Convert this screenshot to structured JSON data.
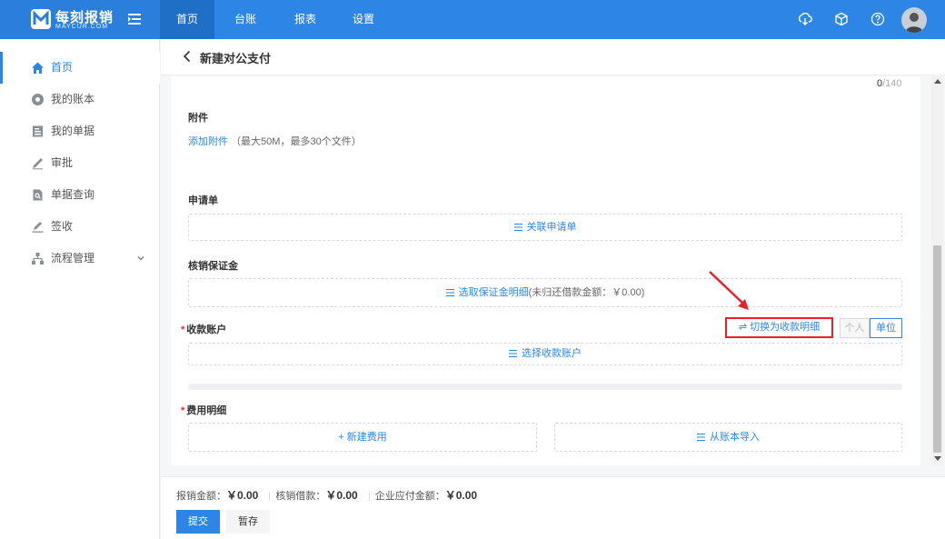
{
  "brand": {
    "name": "每刻报销",
    "sub": "MAYCUR.COM"
  },
  "topnav": [
    {
      "label": "首页",
      "active": true
    },
    {
      "label": "台账",
      "active": false
    },
    {
      "label": "报表",
      "active": false
    },
    {
      "label": "设置",
      "active": false
    }
  ],
  "sidebar": {
    "items": [
      {
        "label": "首页",
        "icon": "home-icon",
        "active": true
      },
      {
        "label": "我的账本",
        "icon": "ledger-icon"
      },
      {
        "label": "我的单据",
        "icon": "document-icon"
      },
      {
        "label": "审批",
        "icon": "pen-icon"
      },
      {
        "label": "单据查询",
        "icon": "search-doc-icon"
      },
      {
        "label": "签收",
        "icon": "sign-icon"
      },
      {
        "label": "流程管理",
        "icon": "flow-icon",
        "expandable": true
      }
    ]
  },
  "page": {
    "title": "新建对公支付"
  },
  "form": {
    "counter": {
      "current": "0",
      "total": "/140"
    },
    "attachment": {
      "label": "附件",
      "link": "添加附件",
      "hint": "（最大50M，最多30个文件）"
    },
    "request": {
      "label": "申请单",
      "action": "关联申请单"
    },
    "deposit": {
      "label": "核销保证金",
      "action": "选取保证金明细",
      "note": "(未归还借款金额：￥0.00)"
    },
    "account": {
      "label": "收款账户",
      "switch": "切换为收款明细",
      "seg_personal": "个人",
      "seg_company": "单位",
      "action": "选择收款账户"
    },
    "expense": {
      "label": "费用明细",
      "add": "新建费用",
      "import": "从账本导入"
    }
  },
  "footer": {
    "reimburse_label": "报销金额：",
    "reimburse_value": "￥0.00",
    "writeoff_label": "核销借款：",
    "writeoff_value": "￥0.00",
    "payable_label": "企业应付金额：",
    "payable_value": "￥0.00",
    "submit": "提交",
    "save": "暂存"
  },
  "colors": {
    "primary": "#2d86e6",
    "highlight": "#e8212a"
  }
}
